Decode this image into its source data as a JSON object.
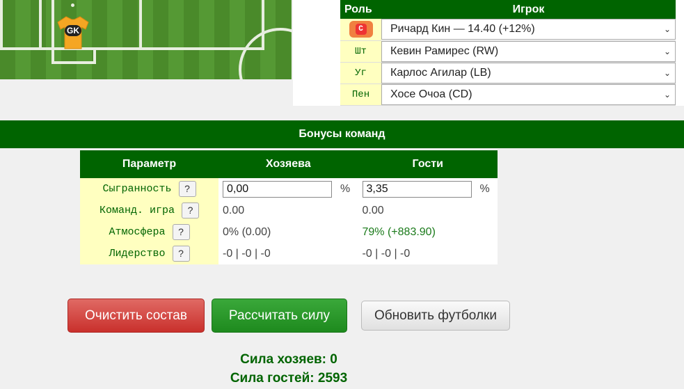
{
  "pitch": {
    "gk_label": "GK"
  },
  "lineup": {
    "header_role": "Роль",
    "header_player": "Игрок",
    "rows": [
      {
        "role": "C",
        "role_icon": "captain-badge-icon",
        "player": "Ричард Кин — 14.40 (+12%)"
      },
      {
        "role": "Шт",
        "player": "Кевин Рамирес (RW)"
      },
      {
        "role": "Уг",
        "player": "Карлос Агилар (LB)"
      },
      {
        "role": "Пен",
        "player": "Хосе Очоа (CD)"
      }
    ]
  },
  "bonuses": {
    "title": "Бонусы команд",
    "headers": {
      "param": "Параметр",
      "home": "Хозяева",
      "away": "Гости"
    },
    "rows": [
      {
        "param": "Сыгранность",
        "help": "?",
        "home": "0,00",
        "home_unit": "%",
        "away": "3,35",
        "away_unit": "%"
      },
      {
        "param": "Команд. игра",
        "help": "?",
        "home": "0.00",
        "away": "0.00"
      },
      {
        "param": "Атмосфера",
        "help": "?",
        "home": "0% (0.00)",
        "away": "79% (+883.90)"
      },
      {
        "param": "Лидерство",
        "help": "?",
        "home": "-0 | -0 | -0",
        "away": "-0 | -0 | -0"
      }
    ]
  },
  "buttons": {
    "clear": "Очистить состав",
    "calc": "Рассчитать силу",
    "refresh": "Обновить футболки"
  },
  "strength": {
    "home": "Сила хозяев: 0",
    "away": "Сила гостей: 2593"
  },
  "colors": {
    "header_green": "#006400",
    "param_bg": "#ffffc0",
    "shirt": "#f5a623"
  }
}
